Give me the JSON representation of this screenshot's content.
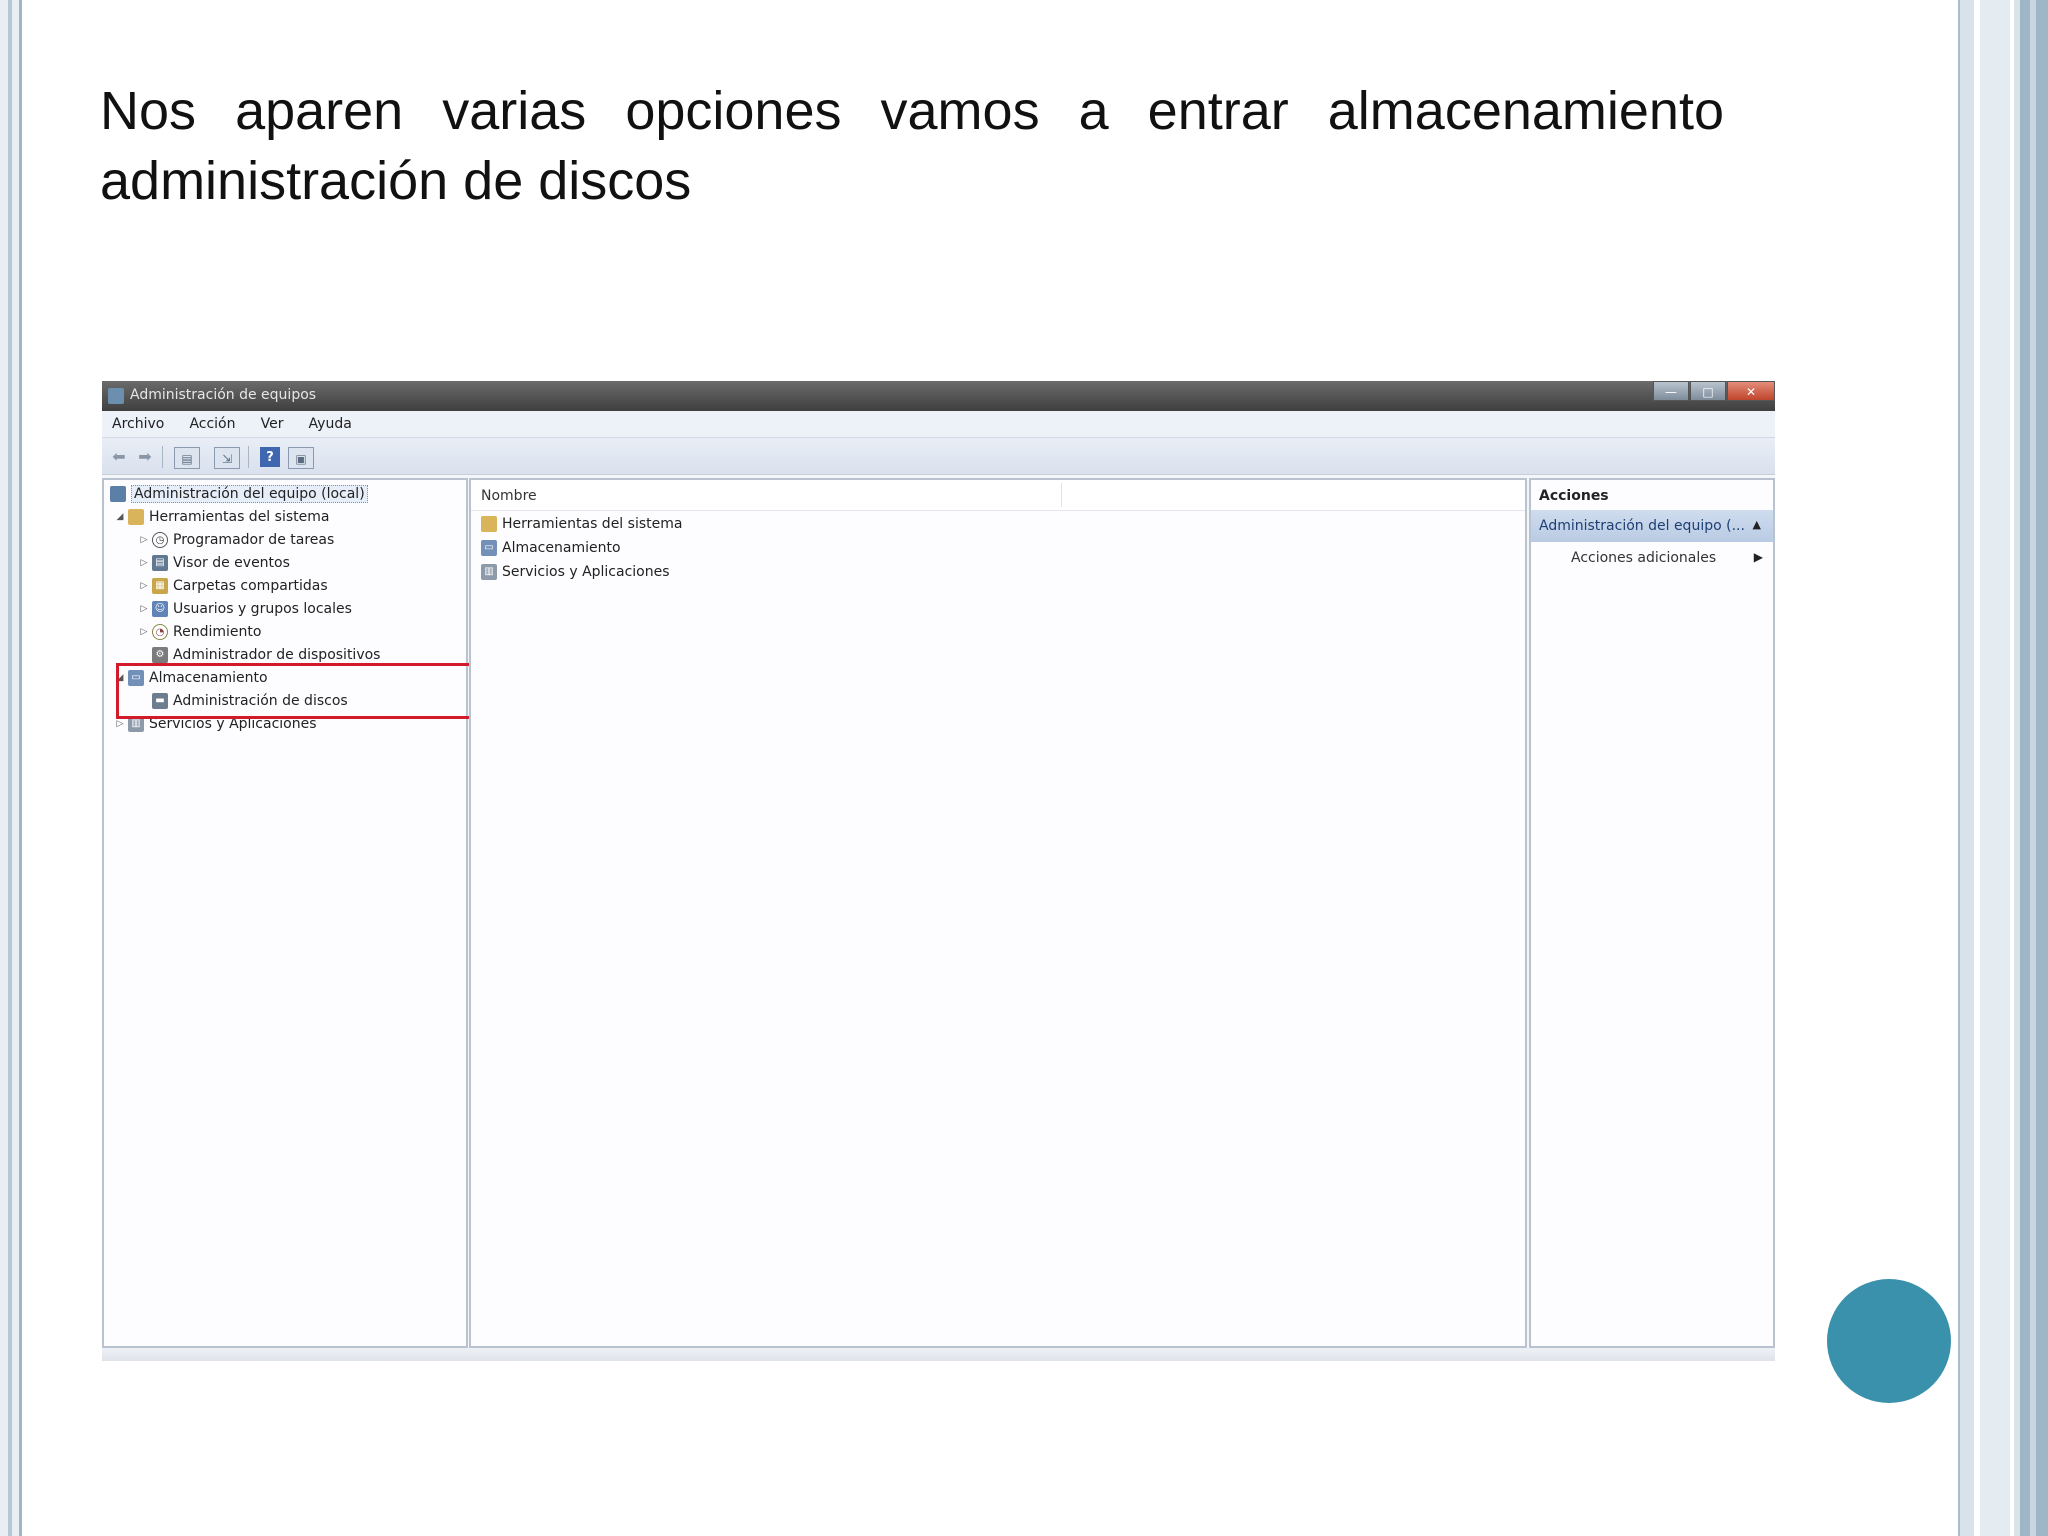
{
  "slide": {
    "title": "Nos aparen varias opciones vamos a entrar  almacenamiento administración  de discos"
  },
  "window": {
    "title": "Administración de equipos",
    "buttons": {
      "minimize": "—",
      "maximize": "□",
      "close": "✕"
    },
    "menu": [
      "Archivo",
      "Acción",
      "Ver",
      "Ayuda"
    ]
  },
  "tree": {
    "items": [
      {
        "label": "Administración del equipo (local)",
        "icon": "computer-icon",
        "expander": ""
      },
      {
        "label": "Herramientas del sistema",
        "icon": "tools-icon",
        "expander": "◢"
      },
      {
        "label": "Programador de tareas",
        "icon": "clock-icon",
        "expander": "▷"
      },
      {
        "label": "Visor de eventos",
        "icon": "event-viewer-icon",
        "expander": "▷"
      },
      {
        "label": "Carpetas compartidas",
        "icon": "shared-folder-icon",
        "expander": "▷"
      },
      {
        "label": "Usuarios y grupos locales",
        "icon": "users-icon",
        "expander": "▷"
      },
      {
        "label": "Rendimiento",
        "icon": "performance-icon",
        "expander": "▷"
      },
      {
        "label": "Administrador de dispositivos",
        "icon": "device-manager-icon",
        "expander": ""
      },
      {
        "label": "Almacenamiento",
        "icon": "storage-icon",
        "expander": "◢"
      },
      {
        "label": "Administración de discos",
        "icon": "disk-icon",
        "expander": ""
      },
      {
        "label": "Servicios y Aplicaciones",
        "icon": "services-icon",
        "expander": "▷"
      }
    ]
  },
  "center": {
    "column_header": "Nombre",
    "items": [
      {
        "label": "Herramientas del sistema",
        "icon": "tools-icon"
      },
      {
        "label": "Almacenamiento",
        "icon": "storage-icon"
      },
      {
        "label": "Servicios y Aplicaciones",
        "icon": "services-icon"
      }
    ]
  },
  "actions": {
    "header": "Acciones",
    "section": "Administración del equipo (...",
    "section_caret": "▲",
    "item": "Acciones adicionales",
    "item_caret": "▶"
  },
  "colors": {
    "highlight": "#d11a2a",
    "accent_circle": "#3a91ab"
  }
}
